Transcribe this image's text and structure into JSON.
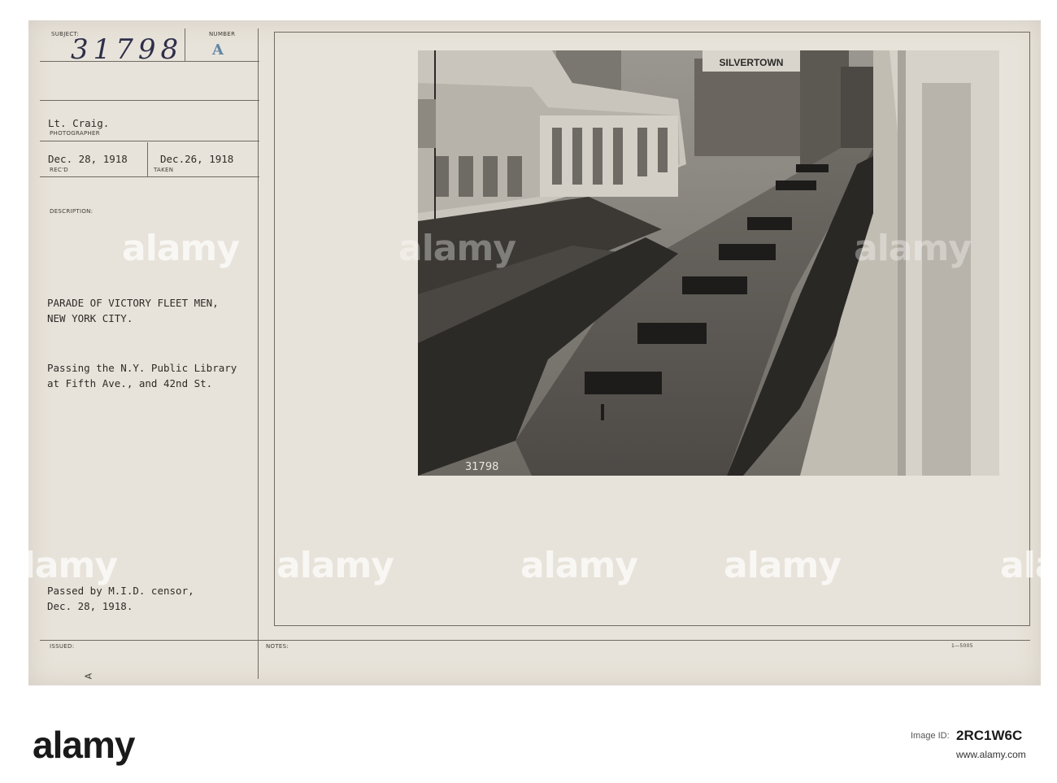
{
  "card": {
    "subject_label": "SUBJECT:",
    "subject_number": "31798",
    "number_label": "NUMBER",
    "number_value": "A",
    "photographer_name": "Lt. Craig.",
    "photographer_label": "PHOTOGRAPHER",
    "received_date": "Dec. 28, 1918",
    "received_label": "REC'D",
    "taken_date": "Dec.26, 1918",
    "taken_label": "TAKEN",
    "description_label": "DESCRIPTION:",
    "title_line1": "PARADE OF VICTORY FLEET MEN,",
    "title_line2": "NEW YORK CITY.",
    "detail_line1": "Passing the N.Y. Public Library",
    "detail_line2": "at Fifth Ave., and 42nd St.",
    "censor_line1": "Passed by M.I.D. censor,",
    "censor_line2": "Dec. 28, 1918.",
    "issued_label": "ISSUED:",
    "notes_label": "NOTES:",
    "form_code": "1—5005",
    "corner_mark": "A"
  },
  "photo": {
    "sign_text": "SILVERTOWN",
    "negative_number": "31798"
  },
  "watermark": {
    "text": "alamy"
  },
  "footer": {
    "brand": "alamy",
    "image_id": "2RC1W6C",
    "url": "www.alamy.com"
  }
}
